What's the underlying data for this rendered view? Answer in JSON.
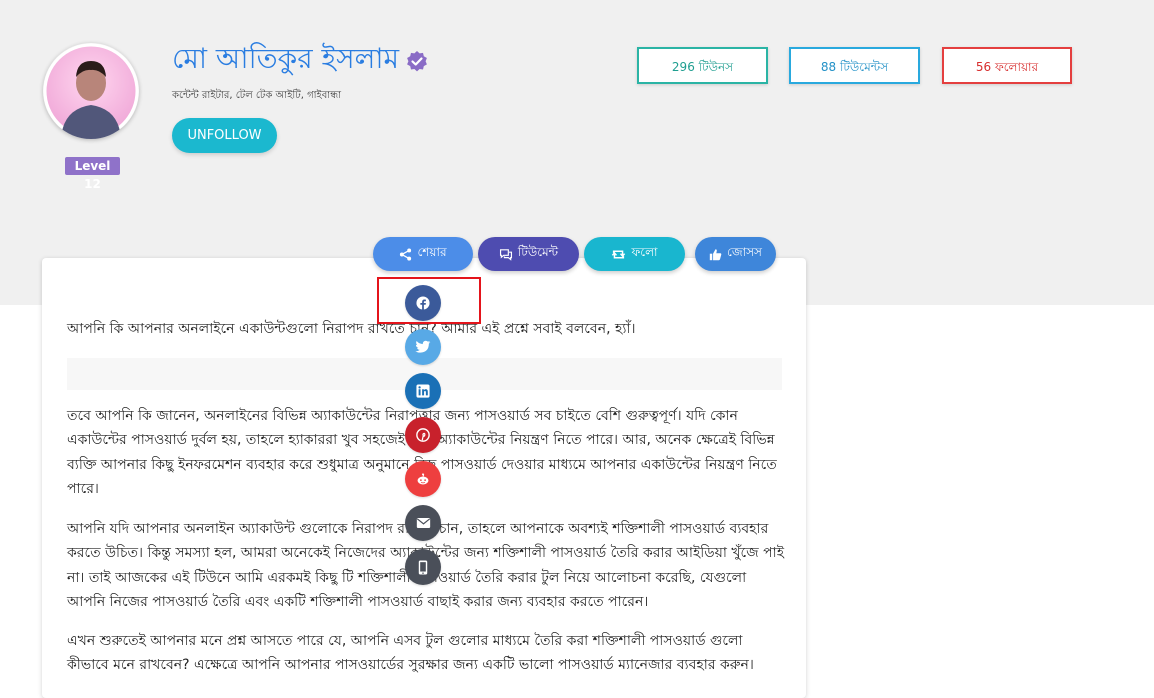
{
  "profile": {
    "name": "মো আতিকুর ইসলাম",
    "subtitle": "কন্টেন্ট রাইটার, টেল টেক আইটি, গাইবান্ধা",
    "level": "Level 12",
    "unfollow_label": "UNFOLLOW",
    "verified_icon": "verified-badge-icon",
    "avatar_icon": "profile-photo"
  },
  "stats": {
    "tunes": "296 টিউনস",
    "tuments": "88 টিউমেন্টস",
    "followers": "56 ফলোয়ার"
  },
  "actions": {
    "share": "শেয়ার",
    "tument": "টিউমেন্ট",
    "follow": "ফলো",
    "josh": "জোসস"
  },
  "share_menu": [
    "facebook-icon",
    "twitter-icon",
    "linkedin-icon",
    "pinterest-icon",
    "reddit-icon",
    "email-icon",
    "phone-icon"
  ],
  "article": {
    "p1": "আপনি কি আপনার অনলাইনে একাউন্টগুলো নিরাপদ রাখতে চান? আমার এই প্রশ্নে সবাই বলবেন, হ্যাঁ।",
    "p2": "তবে আপনি কি জানেন, অনলাইনের বিভিন্ন অ্যাকাউন্টের নিরাপত্তার জন্য পাসওয়ার্ড সব চাইতে বেশি গুরুত্বপূর্ণ। যদি কোন একাউন্টের পাসওয়ার্ড দুর্বল হয়, তাহলে হ্যাকাররা খুব সহজেই সেই অ্যাকাউন্টের নিয়ন্ত্রণ নিতে পারে। আর, অনেক ক্ষেত্রেই বিভিন্ন ব্যক্তি আপনার কিছু ইনফরমেশন ব্যবহার করে শুধুমাত্র অনুমানে কিছু পাসওয়ার্ড দেওয়ার মাধ্যমে আপনার একাউন্টের নিয়ন্ত্রণ নিতে পারে।",
    "p3": "আপনি যদি আপনার অনলাইন অ্যাকাউন্ট গুলোকে নিরাপদ রাখতে চান, তাহলে আপনাকে অবশ্যই শক্তিশালী পাসওয়ার্ড ব্যবহার করতে উচিত। কিন্তু সমস্যা হল, আমরা অনেকেই নিজেদের অ্যাকাউন্টের জন্য শক্তিশালী পাসওয়ার্ড তৈরি করার আইডিয়া খুঁজে পাই না। তাই আজকের এই টিউনে আমি এরকমই কিছু টি শক্তিশালী পাসওয়ার্ড তৈরি করার টুল নিয়ে আলোচনা করেছি, যেগুলো আপনি নিজের পাসওয়ার্ড তৈরি এবং একটি শক্তিশালী পাসওয়ার্ড বাছাই করার জন্য ব্যবহার করতে পারেন।",
    "p4": "এখন শুরুতেই আপনার মনে প্রশ্ন আসতে পারে যে, আপনি এসব টুল গুলোর মাধ্যমে তৈরি করা শক্তিশালী পাসওয়ার্ড গুলো কীভাবে মনে রাখবেন? এক্ষেত্রে আপনি আপনার পাসওয়ার্ডের সুরক্ষার জন্য একটি ভালো পাসওয়ার্ড ম্যানেজার ব্যবহার করুন।"
  }
}
